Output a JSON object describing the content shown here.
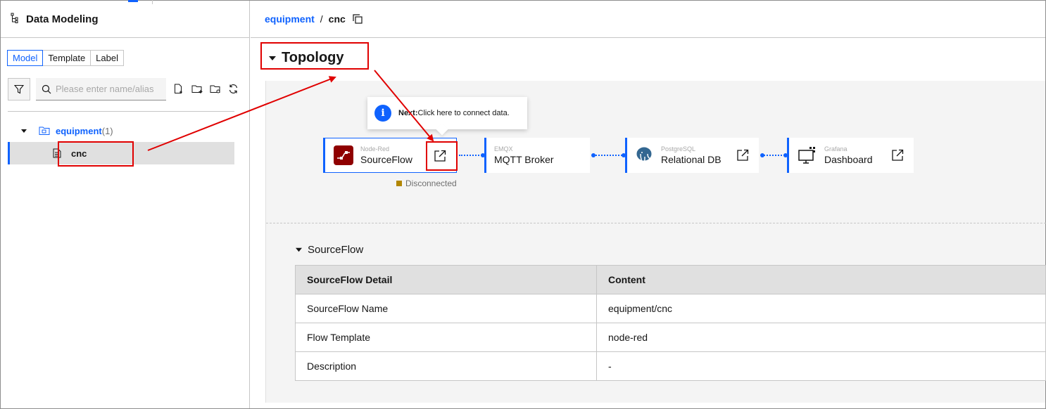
{
  "sidebar": {
    "title": "Data Modeling",
    "tabs": [
      {
        "label": "Model",
        "active": true
      },
      {
        "label": "Template",
        "active": false
      },
      {
        "label": "Label",
        "active": false
      }
    ],
    "search_placeholder": "Please enter name/alias",
    "tree": {
      "folder_label": "equipment",
      "folder_count": "(1)",
      "item_label": "cnc"
    }
  },
  "breadcrumb": {
    "parent": "equipment",
    "separator": "/",
    "current": "cnc"
  },
  "topology": {
    "title": "Topology",
    "tooltip_bold": "Next:",
    "tooltip_text": "Click here to connect data.",
    "nodes": [
      {
        "subtitle": "Node-Red",
        "name": "SourceFlow"
      },
      {
        "subtitle": "EMQX",
        "name": "MQTT Broker"
      },
      {
        "subtitle": "PostgreSQL",
        "name": "Relational DB"
      },
      {
        "subtitle": "Grafana",
        "name": "Dashboard"
      }
    ],
    "status": "Disconnected"
  },
  "sourceflow": {
    "title": "SourceFlow",
    "headers": [
      "SourceFlow Detail",
      "Content"
    ],
    "rows": [
      [
        "SourceFlow Name",
        "equipment/cnc"
      ],
      [
        "Flow Template",
        "node-red"
      ],
      [
        "Description",
        "-"
      ]
    ]
  },
  "colors": {
    "accent": "#0f62fe",
    "annotation": "#e00000",
    "node_red": "#8f0000",
    "status_disconnected": "#b28600"
  }
}
